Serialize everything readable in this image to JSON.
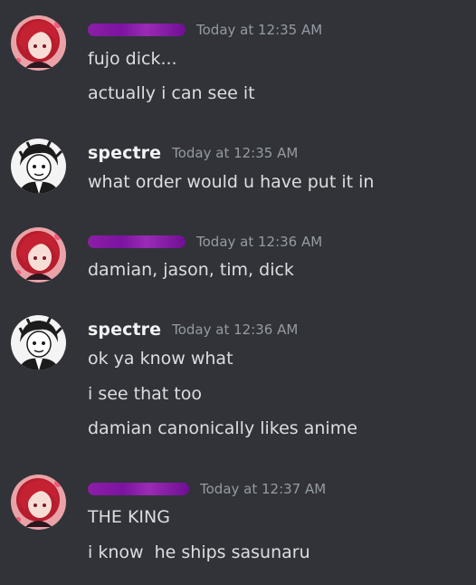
{
  "messages": [
    {
      "author": "",
      "redacted": true,
      "avatar": "red-haired-avatar-icon",
      "timestamp": "Today at 12:35 AM",
      "lines": [
        "fujo dick...",
        "actually i can see it"
      ]
    },
    {
      "author": "spectre",
      "redacted": false,
      "avatar": "sketch-portrait-avatar-icon",
      "timestamp": "Today at 12:35 AM",
      "lines": [
        "what order would u have put it in"
      ]
    },
    {
      "author": "",
      "redacted": true,
      "avatar": "red-haired-avatar-icon",
      "timestamp": "Today at 12:36 AM",
      "lines": [
        "damian, jason, tim, dick"
      ]
    },
    {
      "author": "spectre",
      "redacted": false,
      "avatar": "sketch-portrait-avatar-icon",
      "timestamp": "Today at 12:36 AM",
      "lines": [
        "ok ya know what",
        "i see that too",
        "damian canonically likes anime"
      ]
    },
    {
      "author": "",
      "redacted": true,
      "avatar": "red-haired-avatar-icon",
      "timestamp": "Today at 12:37 AM",
      "lines": [
        "THE KING",
        "i know  he ships sasunaru"
      ]
    }
  ],
  "colors": {
    "background": "#313338",
    "username": "#f2f3f5",
    "timestamp": "#949ba4",
    "message_text": "#dbdee1",
    "redaction": "#8c1ea6"
  }
}
